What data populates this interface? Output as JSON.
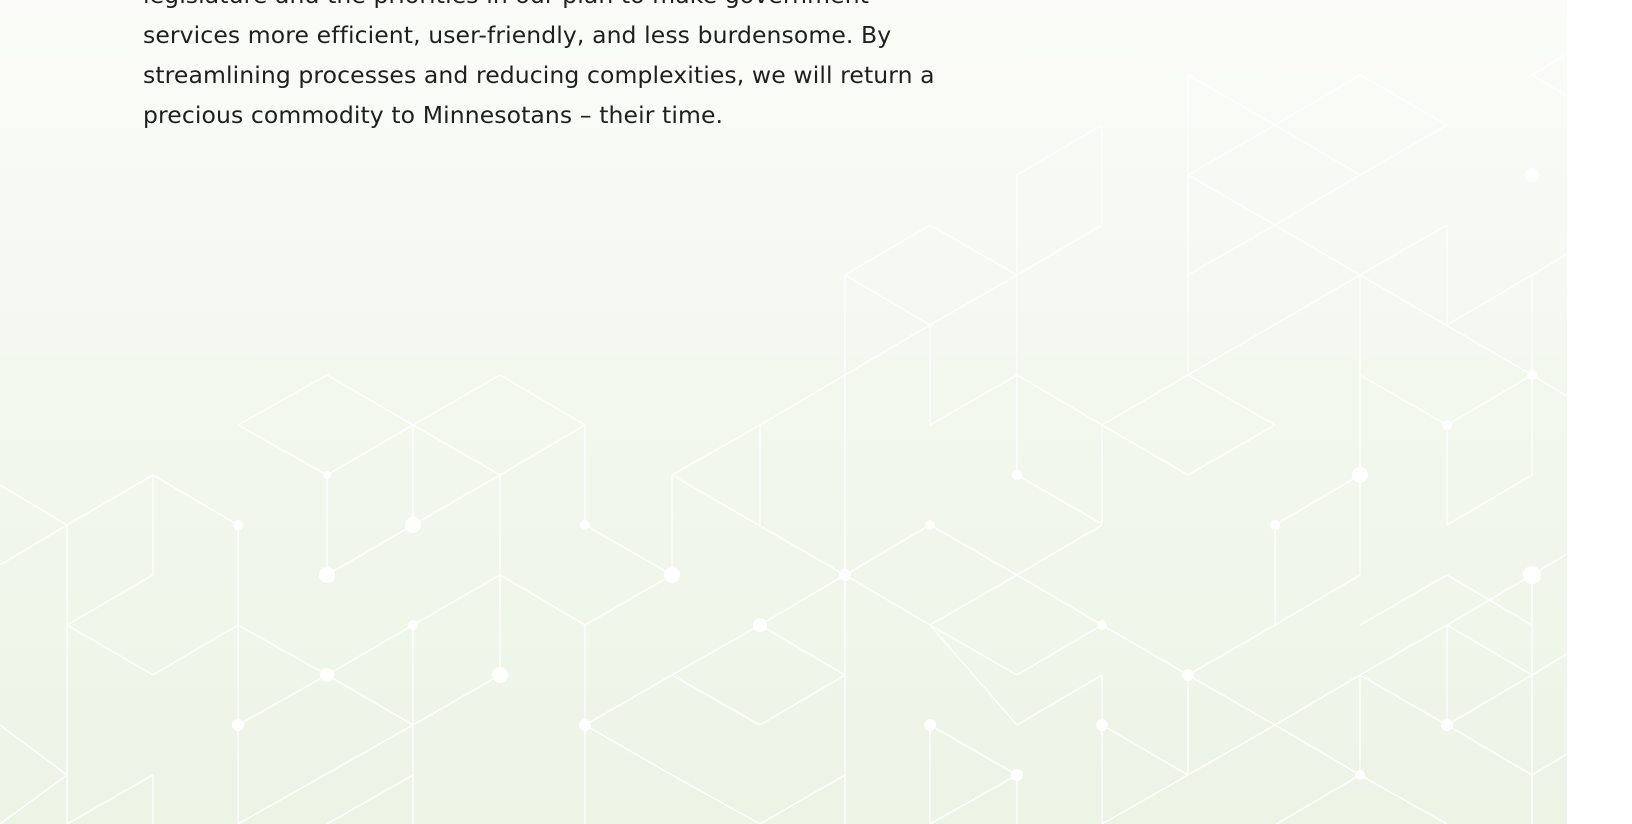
{
  "document": {
    "paragraph_lines": [
      "legislature and the priorities in our plan to make government",
      "services more efficient, user-friendly, and less burdensome. By",
      "streamlining processes and reducing complexities, we will return a",
      "precious commodity to Minnesotans – their time."
    ]
  },
  "background": {
    "pattern": "white isometric line network",
    "gradient": [
      "#fbfcf9",
      "#ecf4e6"
    ]
  }
}
